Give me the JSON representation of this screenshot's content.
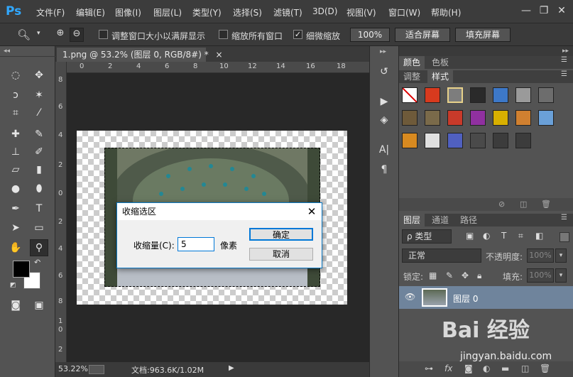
{
  "app": {
    "logo": "Ps"
  },
  "menu": [
    "文件(F)",
    "编辑(E)",
    "图像(I)",
    "图层(L)",
    "类型(Y)",
    "选择(S)",
    "滤镜(T)",
    "3D(D)",
    "视图(V)",
    "窗口(W)",
    "帮助(H)"
  ],
  "window_controls": {
    "minimize": "—",
    "restore": "❐",
    "close": "✕"
  },
  "options": {
    "resize_windows": "调整窗口大小以满屏显示",
    "zoom_all": "缩放所有窗口",
    "scrubby_zoom": "细微缩放",
    "pct_100": "100%",
    "fit_screen": "适合屏幕",
    "fill_screen": "填充屏幕"
  },
  "document": {
    "tab_title": "1.png @ 53.2% (图层 0, RGB/8#) *",
    "tab_close": "×",
    "zoom": "53.22%",
    "doc_info": "文档:963.6K/1.02M",
    "ruler_top": [
      "0",
      "2",
      "4",
      "6",
      "8",
      "10",
      "12",
      "14",
      "16",
      "18"
    ],
    "ruler_left": [
      "8",
      "6",
      "4",
      "2",
      "0",
      "2",
      "4",
      "6",
      "8",
      "1",
      "0",
      "2"
    ]
  },
  "dialog": {
    "title": "收缩选区",
    "close": "✕",
    "label": "收缩量(C):",
    "value": "5",
    "unit": "像素",
    "ok": "确定",
    "cancel": "取消"
  },
  "panels": {
    "top_tabs": [
      "颜色",
      "色板"
    ],
    "second_tabs": [
      "调整",
      "样式"
    ],
    "layer_tabs": [
      "图层",
      "通道",
      "路径"
    ],
    "kind_filter": "ρ 类型",
    "blend_mode": "正常",
    "opacity_label": "不透明度:",
    "opacity_value": "100%",
    "lock_label": "锁定:",
    "fill_label": "填充:",
    "fill_value": "100%",
    "layer_name": "图层 0"
  },
  "style_swatches": [
    "#ffffff",
    "#d83a1e",
    "#7d7d7d",
    "#2a2a2a",
    "#3d78c8",
    "#9a9a9a",
    "#6d6d6d",
    "#6e5a3a",
    "#7a6a4a",
    "#c83a2a",
    "#9030a0",
    "#d8b000",
    "#d08030",
    "#6aa0d8",
    "#d88a20",
    "#e0e0e0",
    "#5060c0",
    "#4a4a4a",
    "#3c3c3c",
    "#3c3c3c"
  ],
  "colors": {
    "foreground": "#000000",
    "background": "#ffffff",
    "accent": "#31a8ff",
    "dialog_border": "#0b79c5"
  },
  "watermark": {
    "text": "Bai 经验",
    "url": "jingyan.baidu.com"
  }
}
